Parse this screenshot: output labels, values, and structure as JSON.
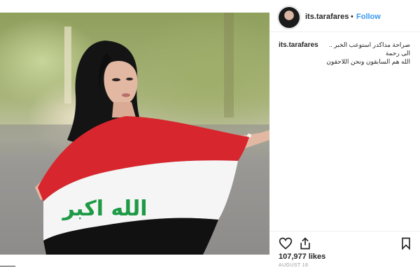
{
  "post": {
    "username": "its.tarafares",
    "separator": "•",
    "follow_label": "Follow",
    "caption_line1": "صراحة مداكدر استوعب الخبر .. الى رحمة",
    "caption_line2": "الله هم السابقون ونحن اللاحقون",
    "likes": "107,977 likes",
    "date": "AUGUST 16",
    "photo_flag_text": "الله اكبر"
  },
  "icons": {
    "like": "heart-icon",
    "share": "share-icon",
    "save": "bookmark-icon",
    "avatar": "profile-avatar"
  },
  "colors": {
    "follow": "#3897f0",
    "flag_red": "#d7262d",
    "flag_green": "#1d9a45",
    "flag_black": "#111111"
  }
}
